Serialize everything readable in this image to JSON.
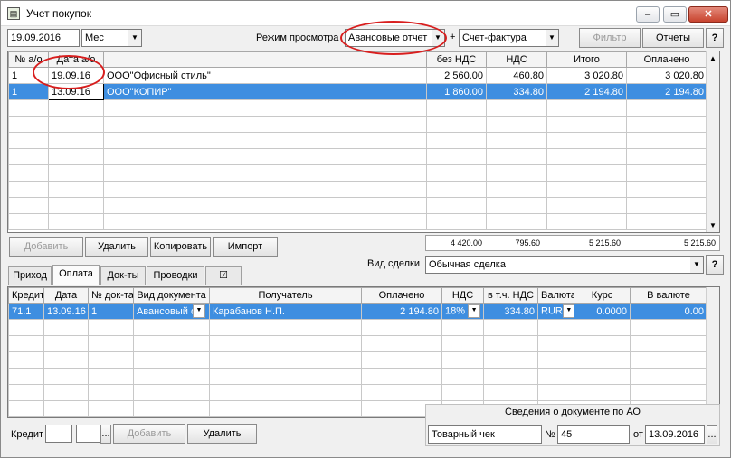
{
  "window": {
    "title": "Учет покупок",
    "controls": {
      "minimize": "‒",
      "maximize": "▭",
      "close": "✕"
    }
  },
  "toolbar": {
    "date": "19.09.2016",
    "period": "Мес",
    "view_mode_label": "Режим просмотра",
    "view_mode_value": "Авансовые отчет",
    "plus": "+",
    "doc_type": "Счет-фактура",
    "filter_label": "Фильтр",
    "reports_label": "Отчеты",
    "help_label": "?"
  },
  "top_table": {
    "columns": [
      "№ а/о",
      "Дата а/о",
      "",
      "без НДС",
      "НДС",
      "Итого",
      "Оплачено"
    ],
    "rows": [
      [
        "1",
        "19.09.16",
        "ООО\"Офисный стиль\"",
        "2 560.00",
        "460.80",
        "3 020.80",
        "3 020.80"
      ],
      [
        "1",
        "13.09.16",
        "ООО\"КОПИР\"",
        "1 860.00",
        "334.80",
        "2 194.80",
        "2 194.80"
      ]
    ],
    "selected_row": 1,
    "totals": [
      "4 420.00",
      "795.60",
      "5 215.60",
      "5 215.60"
    ]
  },
  "top_buttons": {
    "add": "Добавить",
    "delete": "Удалить",
    "copy": "Копировать",
    "import": "Импорт"
  },
  "deal": {
    "label": "Вид сделки",
    "value": "Обычная сделка",
    "help": "?"
  },
  "tabs": [
    "Приход",
    "Оплата",
    "Док-ты",
    "Проводки",
    "☑"
  ],
  "active_tab": 1,
  "pay_table": {
    "columns": [
      "Кредит",
      "Дата",
      "№ док-та",
      "Вид документа",
      "Получатель",
      "Оплачено",
      "НДС",
      "в т.ч. НДС",
      "Валюта",
      "Курс",
      "В валюте"
    ],
    "rows": [
      [
        "71.1",
        "13.09.16",
        "1",
        "Авансовый о",
        "Карабанов Н.П.",
        "2 194.80",
        "18%",
        "334.80",
        "RUR",
        "0.0000",
        "0.00"
      ]
    ]
  },
  "bottom": {
    "credit_label": "Кредит",
    "credit_ellipsis": "...",
    "add": "Добавить",
    "delete": "Удалить"
  },
  "ao_info": {
    "header": "Сведения о документе по АО",
    "doc_type": "Товарный чек",
    "number_label": "№",
    "number": "45",
    "date_label": "от",
    "date": "13.09.2016"
  },
  "colors": {
    "selection": "#3e8ee0",
    "annotation": "#d81e1e"
  }
}
